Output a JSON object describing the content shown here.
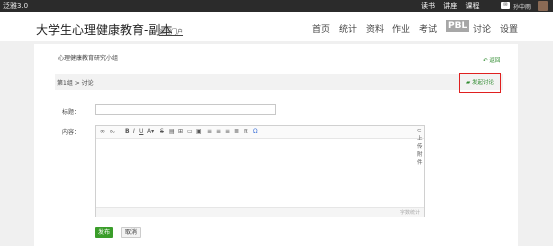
{
  "topbar": {
    "brand": "泛雅3.0",
    "nav": [
      "读书",
      "讲座",
      "课程"
    ],
    "user_name": "孙中雨"
  },
  "header": {
    "course_title": "大学生心理健康教育-副本",
    "portal_link": "课程门户",
    "nav": [
      "首页",
      "统计",
      "资料",
      "作业",
      "考试",
      "PBL",
      "讨论",
      "设置"
    ],
    "active_nav": "PBL"
  },
  "group": {
    "title": "心理健康教育研究小组",
    "back": "返回",
    "breadcrumb": "第1组 > 讨论",
    "new_discussion": "发起讨论"
  },
  "form": {
    "title_label": "标题：",
    "content_label": "内容：",
    "title_value": "",
    "attach_label": "上传附件",
    "word_count_label": "字数统计",
    "toolbar_icons": [
      "link-icon",
      "unlink-icon",
      "bold-icon",
      "italic-icon",
      "underline-icon",
      "font-color-icon",
      "strikethrough-icon",
      "paste-icon",
      "table-icon",
      "video-icon",
      "image-icon",
      "align-left-icon",
      "align-center-icon",
      "align-right-icon",
      "justify-icon",
      "formula-icon",
      "special-char-icon"
    ],
    "publish": "发布",
    "cancel": "取消"
  },
  "colors": {
    "accent_green": "#3a9d2a",
    "highlight_red": "#e02020",
    "topbar": "#2b2b2b"
  }
}
